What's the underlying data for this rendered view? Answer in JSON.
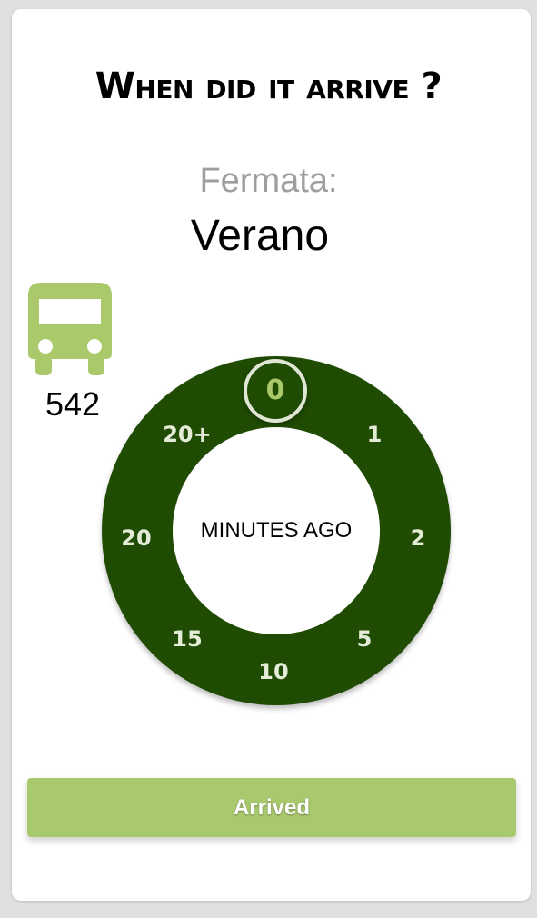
{
  "header": {
    "title": "When did it arrive ?"
  },
  "stop": {
    "label": "Fermata:",
    "name": "Verano"
  },
  "bus": {
    "icon": "bus-icon",
    "number": "542"
  },
  "dial": {
    "center_label": "MINUTES AGO",
    "selected": "0",
    "options": [
      "0",
      "1",
      "2",
      "5",
      "10",
      "15",
      "20",
      "20+"
    ]
  },
  "actions": {
    "arrived_label": "Arrived"
  },
  "colors": {
    "ring": "#1f4b03",
    "accent": "#a9c96f",
    "tick_text": "#e4ecd8"
  }
}
